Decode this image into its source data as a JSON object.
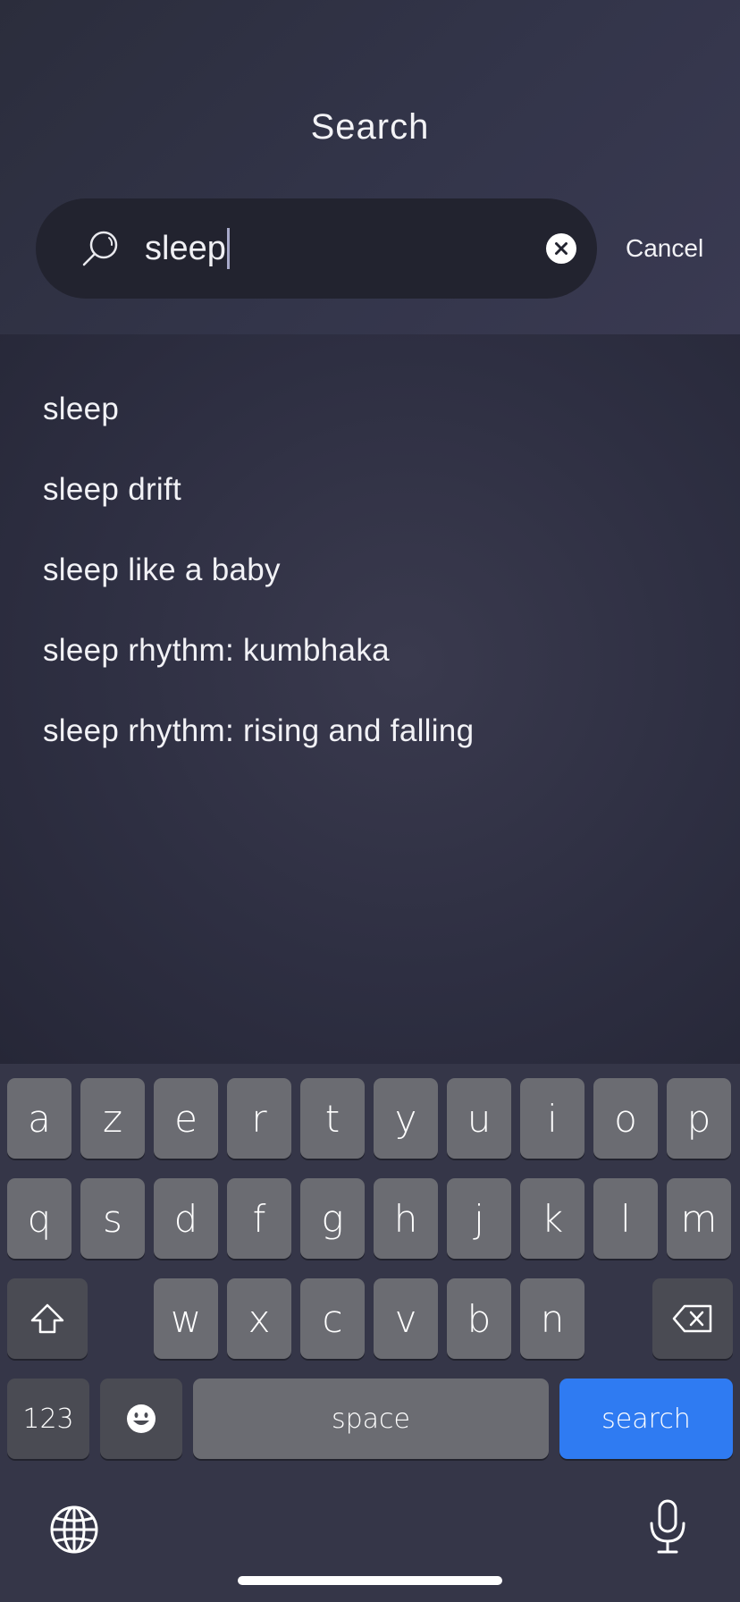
{
  "header": {
    "title": "Search",
    "search_value": "sleep",
    "cancel_label": "Cancel"
  },
  "results": [
    "sleep",
    "sleep drift",
    "sleep like a baby",
    "sleep rhythm: kumbhaka",
    "sleep rhythm: rising and falling"
  ],
  "keyboard": {
    "row1": [
      "a",
      "z",
      "e",
      "r",
      "t",
      "y",
      "u",
      "i",
      "o",
      "p"
    ],
    "row2": [
      "q",
      "s",
      "d",
      "f",
      "g",
      "h",
      "j",
      "k",
      "l",
      "m"
    ],
    "row3": [
      "w",
      "x",
      "c",
      "v",
      "b",
      "n"
    ],
    "numbers_label": "123",
    "space_label": "space",
    "search_label": "search"
  },
  "icons": {
    "search": "magnifier-icon",
    "clear": "clear-circle-icon",
    "shift": "shift-icon",
    "backspace": "backspace-icon",
    "emoji": "emoji-icon",
    "globe": "globe-icon",
    "mic": "microphone-icon"
  },
  "colors": {
    "accent": "#2f7bf2",
    "background": "#2a2a3a"
  }
}
